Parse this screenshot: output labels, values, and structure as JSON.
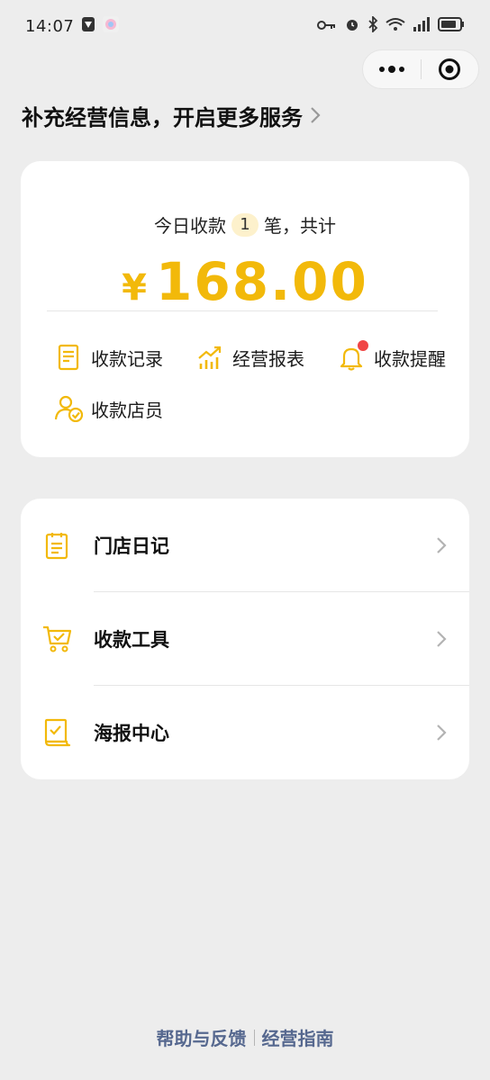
{
  "status_bar": {
    "time": "14:07",
    "icons": [
      "shield-icon",
      "pinwheel-icon",
      "key-icon",
      "alarm-icon",
      "bluetooth-icon",
      "wifi-icon",
      "signal-icon",
      "battery-icon"
    ]
  },
  "capsule": {
    "more_icon": "more-dots-icon",
    "close_icon": "target-close-icon"
  },
  "promo": {
    "text": "补充经营信息，开启更多服务"
  },
  "summary": {
    "prefix": "今日收款",
    "count": "1",
    "suffix": "笔，共计",
    "currency": "¥",
    "amount": "168.00"
  },
  "quick_actions": [
    {
      "label": "收款记录",
      "icon": "receipt-record-icon"
    },
    {
      "label": "经营报表",
      "icon": "chart-report-icon"
    },
    {
      "label": "收款提醒",
      "icon": "bell-icon",
      "has_dot": true
    },
    {
      "label": "收款店员",
      "icon": "staff-check-icon"
    }
  ],
  "menu": [
    {
      "label": "门店日记",
      "icon": "clipboard-icon"
    },
    {
      "label": "收款工具",
      "icon": "cart-icon"
    },
    {
      "label": "海报中心",
      "icon": "poster-check-icon"
    }
  ],
  "footer": {
    "help": "帮助与反馈",
    "guide": "经营指南"
  },
  "colors": {
    "accent": "#f2b90a",
    "link": "#56688f",
    "dot": "#f04545",
    "bg": "#ededed"
  }
}
